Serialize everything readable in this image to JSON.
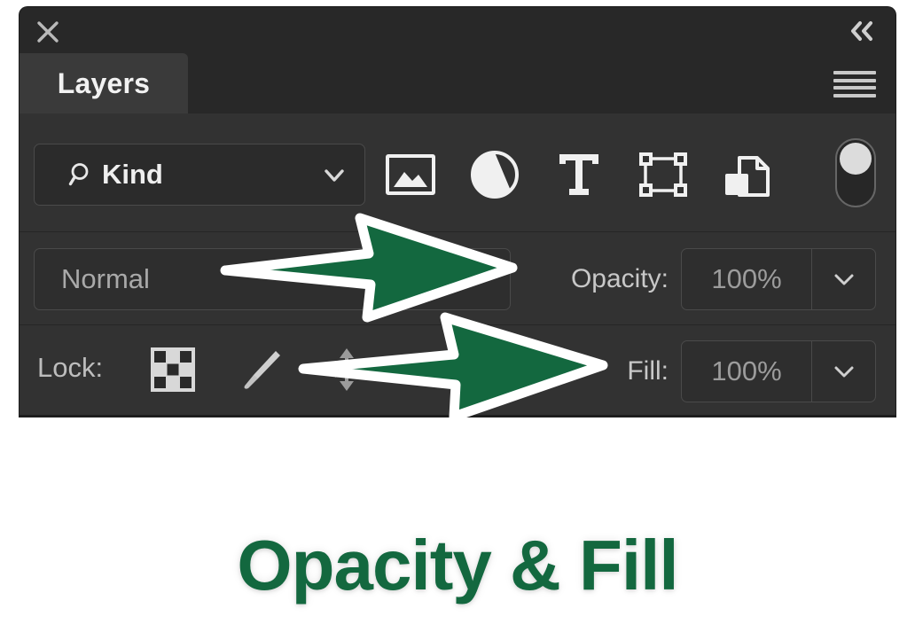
{
  "panel": {
    "title": "Layers",
    "close_icon": "close-icon",
    "collapse_icon": "double-chevron-left-icon",
    "menu_icon": "panel-menu-icon"
  },
  "filter": {
    "search_icon": "search-icon",
    "kind_label": "Kind",
    "caret_icon": "chevron-down-icon",
    "type_icons": [
      {
        "name": "pixel-layer-filter-icon",
        "title": "Filter for pixel layers"
      },
      {
        "name": "adjustment-layer-filter-icon",
        "title": "Filter for adjustment layers"
      },
      {
        "name": "type-layer-filter-icon",
        "title": "Filter for type layers"
      },
      {
        "name": "shape-layer-filter-icon",
        "title": "Filter for shape layers"
      },
      {
        "name": "smart-object-filter-icon",
        "title": "Filter for smart objects"
      }
    ],
    "toggle": {
      "name": "filter-enable-toggle",
      "state": "on"
    }
  },
  "blend": {
    "mode": "Normal",
    "opacity_caption": "Opacity:",
    "opacity_value": "100%",
    "opacity_caret_icon": "chevron-down-icon"
  },
  "lock": {
    "caption": "Lock:",
    "icons": [
      {
        "name": "lock-transparent-pixels-icon",
        "title": "Lock transparent pixels"
      },
      {
        "name": "lock-image-pixels-icon",
        "title": "Lock image pixels"
      },
      {
        "name": "lock-position-icon",
        "title": "Lock position"
      }
    ],
    "fill_caption": "Fill:",
    "fill_value": "100%",
    "fill_caret_icon": "chevron-down-icon"
  },
  "annotations": [
    {
      "name": "arrow-to-opacity",
      "icon": "arrow-right-icon",
      "target": "Opacity:"
    },
    {
      "name": "arrow-to-fill",
      "icon": "arrow-right-icon",
      "target": "Fill:"
    }
  ],
  "caption": {
    "text": "Opacity & Fill"
  },
  "colors": {
    "panel_bg": "#323232",
    "header_bg": "#282828",
    "tab_bg": "#3a3a3a",
    "accent_green": "#13683f",
    "arrow_outline": "#ffffff",
    "page_bg": "#ffffff"
  }
}
